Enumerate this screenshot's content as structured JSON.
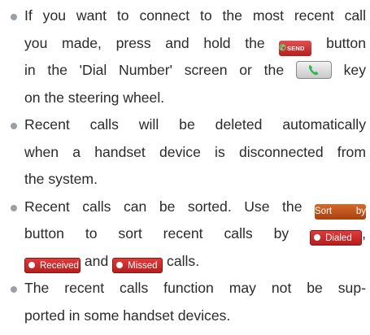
{
  "items": [
    {
      "line1": "If you want to connect to the most recent call",
      "line2_pre": "you made, press and hold the",
      "send_button_label": "SEND",
      "line2_post": "button",
      "line3_pre": "in the 'Dial Number' screen or the",
      "line3_post": "key",
      "line4": "on the steering wheel."
    },
    {
      "line1": "Recent calls will be deleted automatically",
      "line2": "when a handset device is disconnected from",
      "line3": "the system."
    },
    {
      "line1_pre": "Recent calls can be sorted. Use the",
      "sort_button_label": "Sort by",
      "line2_pre": "button to sort recent calls by",
      "dialed_button_label": "Dialed",
      "line2_post": ",",
      "received_button_label": "Received",
      "line3_mid": "and",
      "missed_button_label": "Missed",
      "line3_post": "calls."
    },
    {
      "line1": "The recent calls function may not be sup-",
      "line2": "ported in some handset devices."
    }
  ],
  "colors": {
    "text": "#2a2a2a",
    "bullet": "#9aa0a6",
    "send_button": "#c62b2b",
    "sort_button": "#c0531c",
    "status_buttons": "#cc2a2a",
    "handset_green": "#2fb84a"
  },
  "icons": {
    "send_button_icon": "green-handset-icon",
    "steering_wheel_key_icon": "green-handset-icon",
    "status_dot": "white-dot-icon"
  }
}
